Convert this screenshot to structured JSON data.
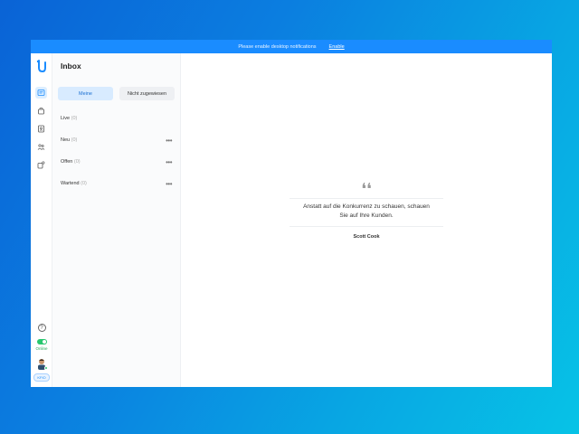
{
  "notification": {
    "message": "Please enable desktop notifications",
    "action_label": "Enable"
  },
  "sidebar": {
    "title": "Inbox",
    "tabs": [
      {
        "label": "Meine",
        "active": true
      },
      {
        "label": "Nicht zugewiesen",
        "active": false
      }
    ],
    "sections": [
      {
        "label": "Live",
        "count": "(0)",
        "has_menu": false
      },
      {
        "label": "Neu",
        "count": "(0)",
        "has_menu": true
      },
      {
        "label": "Offen",
        "count": "(0)",
        "has_menu": true
      },
      {
        "label": "Wartend",
        "count": "(0)",
        "has_menu": true
      }
    ],
    "menu_label": "•••"
  },
  "rail": {
    "icons": [
      "inbox-icon",
      "bag-icon",
      "contacts-icon",
      "team-icon",
      "share-icon"
    ],
    "help_label": "?",
    "status_label": "Online",
    "avatar_tag": "KFIO"
  },
  "main": {
    "quote_mark": "❛❛",
    "quote_line1": "Anstatt auf die Konkurrenz zu schauen, schauen",
    "quote_line2": "Sie auf Ihre Kunden.",
    "author": "Scott Cook"
  },
  "colors": {
    "accent": "#1a8cff",
    "active_tab_bg": "#d8ebff",
    "online": "#28c76f"
  }
}
